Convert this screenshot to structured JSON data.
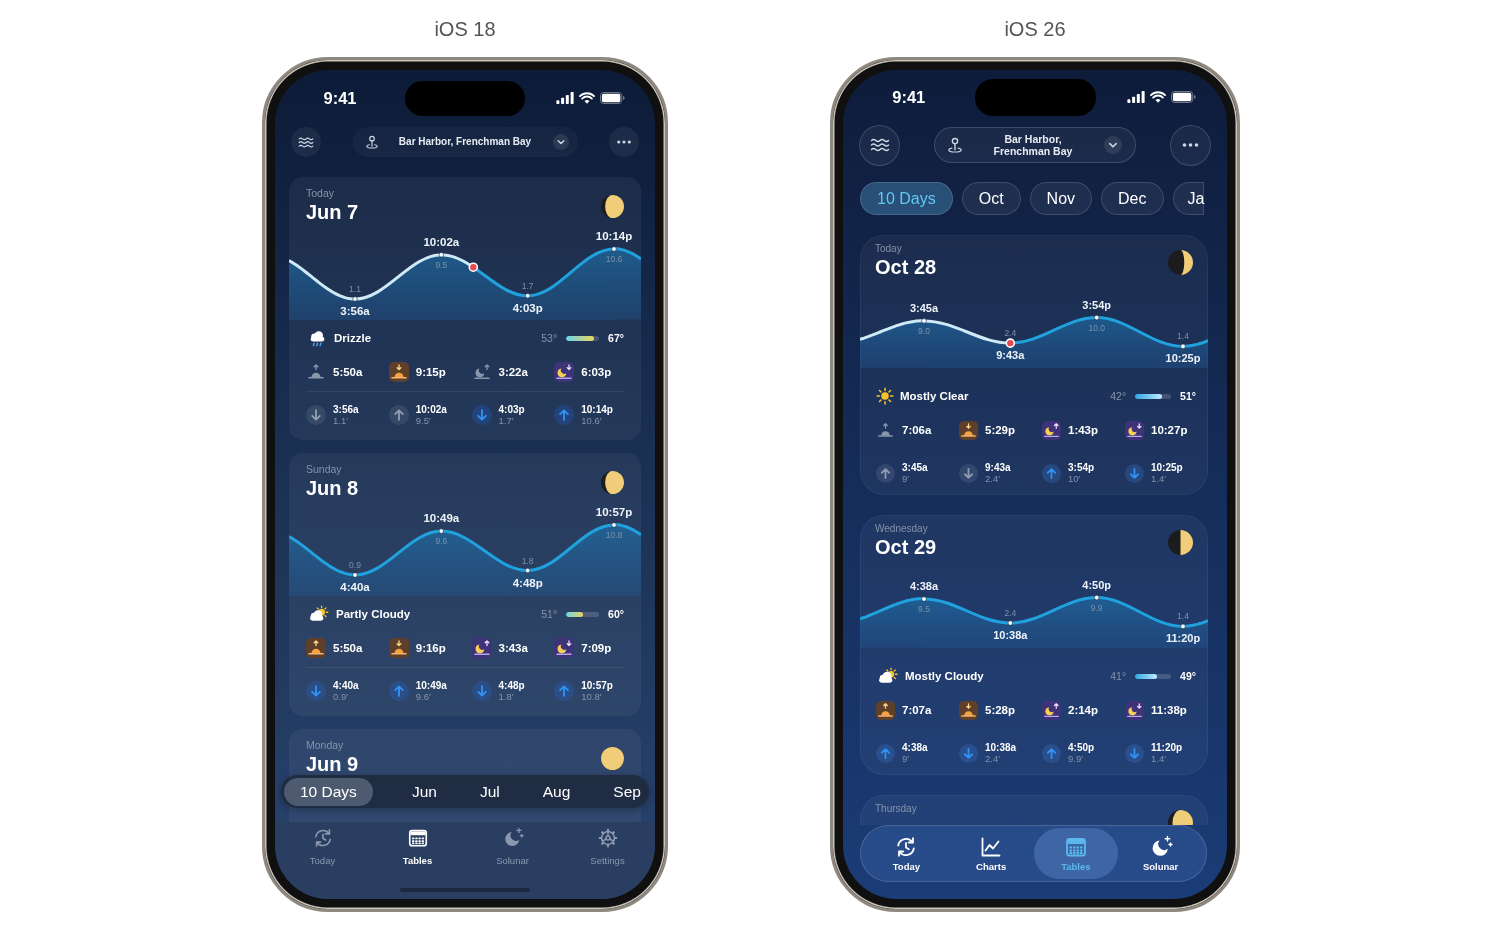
{
  "comparisons": [
    {
      "label": "iOS 18",
      "kind": "classic",
      "phone": {
        "status_bar": {
          "time": "9:41"
        },
        "header": {
          "location": "Bar Harbor, Frenchman Bay"
        },
        "range_tabs": [
          {
            "label": "10 Days",
            "selected": true
          },
          {
            "label": "Jun",
            "selected": false
          },
          {
            "label": "Jul",
            "selected": false
          },
          {
            "label": "Aug",
            "selected": false
          },
          {
            "label": "Sep",
            "selected": false
          }
        ],
        "days": [
          {
            "day": "Today",
            "date": "Jun 7",
            "moon": {
              "kind": "waxing_gibbous"
            },
            "chart_data": {
              "type": "area",
              "categories": [
                "3:56a",
                "10:02a",
                "4:03p",
                "10:14p"
              ],
              "values": [
                1.1,
                9.5,
                1.7,
                10.6
              ],
              "value_labels": [
                "1.1",
                "9.5",
                "1.7",
                "10.6"
              ]
            },
            "weather": {
              "kind": "drizzle",
              "condition": "Drizzle",
              "low": "53°",
              "high": "67°",
              "level": 0.85
            },
            "sun_moon": [
              {
                "kind": "sunrise",
                "time": "5:50a",
                "past": true
              },
              {
                "kind": "sunset",
                "time": "9:15p",
                "past": false
              },
              {
                "kind": "moonrise",
                "time": "3:22a",
                "past": true
              },
              {
                "kind": "moonset",
                "time": "6:03p",
                "past": false
              }
            ],
            "tides": [
              {
                "kind": "low",
                "time": "3:56a",
                "height": "1.1′",
                "past": true
              },
              {
                "kind": "high",
                "time": "10:02a",
                "height": "9.5′",
                "past": true
              },
              {
                "kind": "low",
                "time": "4:03p",
                "height": "1.7′",
                "past": false
              },
              {
                "kind": "high",
                "time": "10:14p",
                "height": "10.6′",
                "past": false
              }
            ]
          },
          {
            "day": "Sunday",
            "date": "Jun 8",
            "moon": {
              "kind": "waxing_gibbous"
            },
            "chart_data": {
              "type": "area",
              "categories": [
                "4:40a",
                "10:49a",
                "4:48p",
                "10:57p"
              ],
              "values": [
                0.9,
                9.6,
                1.8,
                10.8
              ],
              "value_labels": [
                "0.9",
                "9.6",
                "1.8",
                "10.8"
              ]
            },
            "weather": {
              "kind": "partly_cloudy",
              "condition": "Partly Cloudy",
              "low": "51°",
              "high": "60°",
              "level": 0.5
            },
            "sun_moon": [
              {
                "kind": "sunrise",
                "time": "5:50a",
                "past": false
              },
              {
                "kind": "sunset",
                "time": "9:16p",
                "past": false
              },
              {
                "kind": "moonrise",
                "time": "3:43a",
                "past": false
              },
              {
                "kind": "moonset",
                "time": "7:09p",
                "past": false
              }
            ],
            "tides": [
              {
                "kind": "low",
                "time": "4:40a",
                "height": "0.9′",
                "past": false
              },
              {
                "kind": "high",
                "time": "10:49a",
                "height": "9.6′",
                "past": false
              },
              {
                "kind": "low",
                "time": "4:48p",
                "height": "1.8′",
                "past": false
              },
              {
                "kind": "high",
                "time": "10:57p",
                "height": "10.8′",
                "past": false
              }
            ]
          },
          {
            "day": "Monday",
            "date": "Jun 9",
            "moon": {
              "kind": "full"
            }
          }
        ],
        "tab_bar": [
          {
            "kind": "today",
            "label": "Today",
            "selected": false
          },
          {
            "kind": "tables",
            "label": "Tables",
            "selected": true
          },
          {
            "kind": "solunar",
            "label": "Solunar",
            "selected": false
          },
          {
            "kind": "settings",
            "label": "Settings",
            "selected": false
          }
        ]
      }
    },
    {
      "label": "iOS 26",
      "kind": "glass",
      "phone": {
        "status_bar": {
          "time": "9:41"
        },
        "header": {
          "location": "Bar Harbor, Frenchman Bay"
        },
        "range_tabs": [
          {
            "label": "10 Days",
            "selected": true
          },
          {
            "label": "Oct",
            "selected": false
          },
          {
            "label": "Nov",
            "selected": false
          },
          {
            "label": "Dec",
            "selected": false
          },
          {
            "label": "Ja",
            "selected": false
          }
        ],
        "days": [
          {
            "day": "Today",
            "date": "Oct 28",
            "moon": {
              "kind": "waxing_crescent"
            },
            "chart_data": {
              "type": "area",
              "categories": [
                "3:45a",
                "9:43a",
                "3:54p",
                "10:25p"
              ],
              "values": [
                9.0,
                2.4,
                10.0,
                1.4
              ],
              "value_labels": [
                "9.0",
                "2.4",
                "10.0",
                "1.4"
              ]
            },
            "weather": {
              "kind": "clear",
              "condition": "Mostly Clear",
              "low": "42°",
              "high": "51°",
              "level": 0.75
            },
            "sun_moon": [
              {
                "kind": "sunrise",
                "time": "7:06a",
                "past": true
              },
              {
                "kind": "sunset",
                "time": "5:29p",
                "past": false
              },
              {
                "kind": "moonrise",
                "time": "1:43p",
                "past": false
              },
              {
                "kind": "moonset",
                "time": "10:27p",
                "past": false
              }
            ],
            "tides": [
              {
                "kind": "high",
                "time": "3:45a",
                "height": "9′",
                "past": true
              },
              {
                "kind": "low",
                "time": "9:43a",
                "height": "2.4′",
                "past": true
              },
              {
                "kind": "high",
                "time": "3:54p",
                "height": "10′",
                "past": false
              },
              {
                "kind": "low",
                "time": "10:25p",
                "height": "1.4′",
                "past": false
              }
            ]
          },
          {
            "day": "Wednesday",
            "date": "Oct 29",
            "moon": {
              "kind": "first_quarter"
            },
            "chart_data": {
              "type": "area",
              "categories": [
                "4:38a",
                "10:38a",
                "4:50p",
                "11:20p"
              ],
              "values": [
                9.5,
                2.4,
                9.9,
                1.4
              ],
              "value_labels": [
                "9.5",
                "2.4",
                "9.9",
                "1.4"
              ]
            },
            "weather": {
              "kind": "mostly_cloudy",
              "condition": "Mostly Cloudy",
              "low": "41°",
              "high": "49°",
              "level": 0.6
            },
            "sun_moon": [
              {
                "kind": "sunrise",
                "time": "7:07a",
                "past": false
              },
              {
                "kind": "sunset",
                "time": "5:28p",
                "past": false
              },
              {
                "kind": "moonrise",
                "time": "2:14p",
                "past": false
              },
              {
                "kind": "moonset",
                "time": "11:38p",
                "past": false
              }
            ],
            "tides": [
              {
                "kind": "high",
                "time": "4:38a",
                "height": "9′",
                "past": false
              },
              {
                "kind": "low",
                "time": "10:38a",
                "height": "2.4′",
                "past": false
              },
              {
                "kind": "high",
                "time": "4:50p",
                "height": "9.9′",
                "past": false
              },
              {
                "kind": "low",
                "time": "11:20p",
                "height": "1.4′",
                "past": false
              }
            ]
          },
          {
            "day": "Thursday",
            "moon": {
              "kind": "waxing_gibbous"
            }
          }
        ],
        "tab_bar": [
          {
            "kind": "today",
            "label": "Today",
            "selected": false
          },
          {
            "kind": "charts",
            "label": "Charts",
            "selected": false
          },
          {
            "kind": "tables",
            "label": "Tables",
            "selected": true
          },
          {
            "kind": "solunar",
            "label": "Solunar",
            "selected": false
          }
        ]
      }
    }
  ]
}
